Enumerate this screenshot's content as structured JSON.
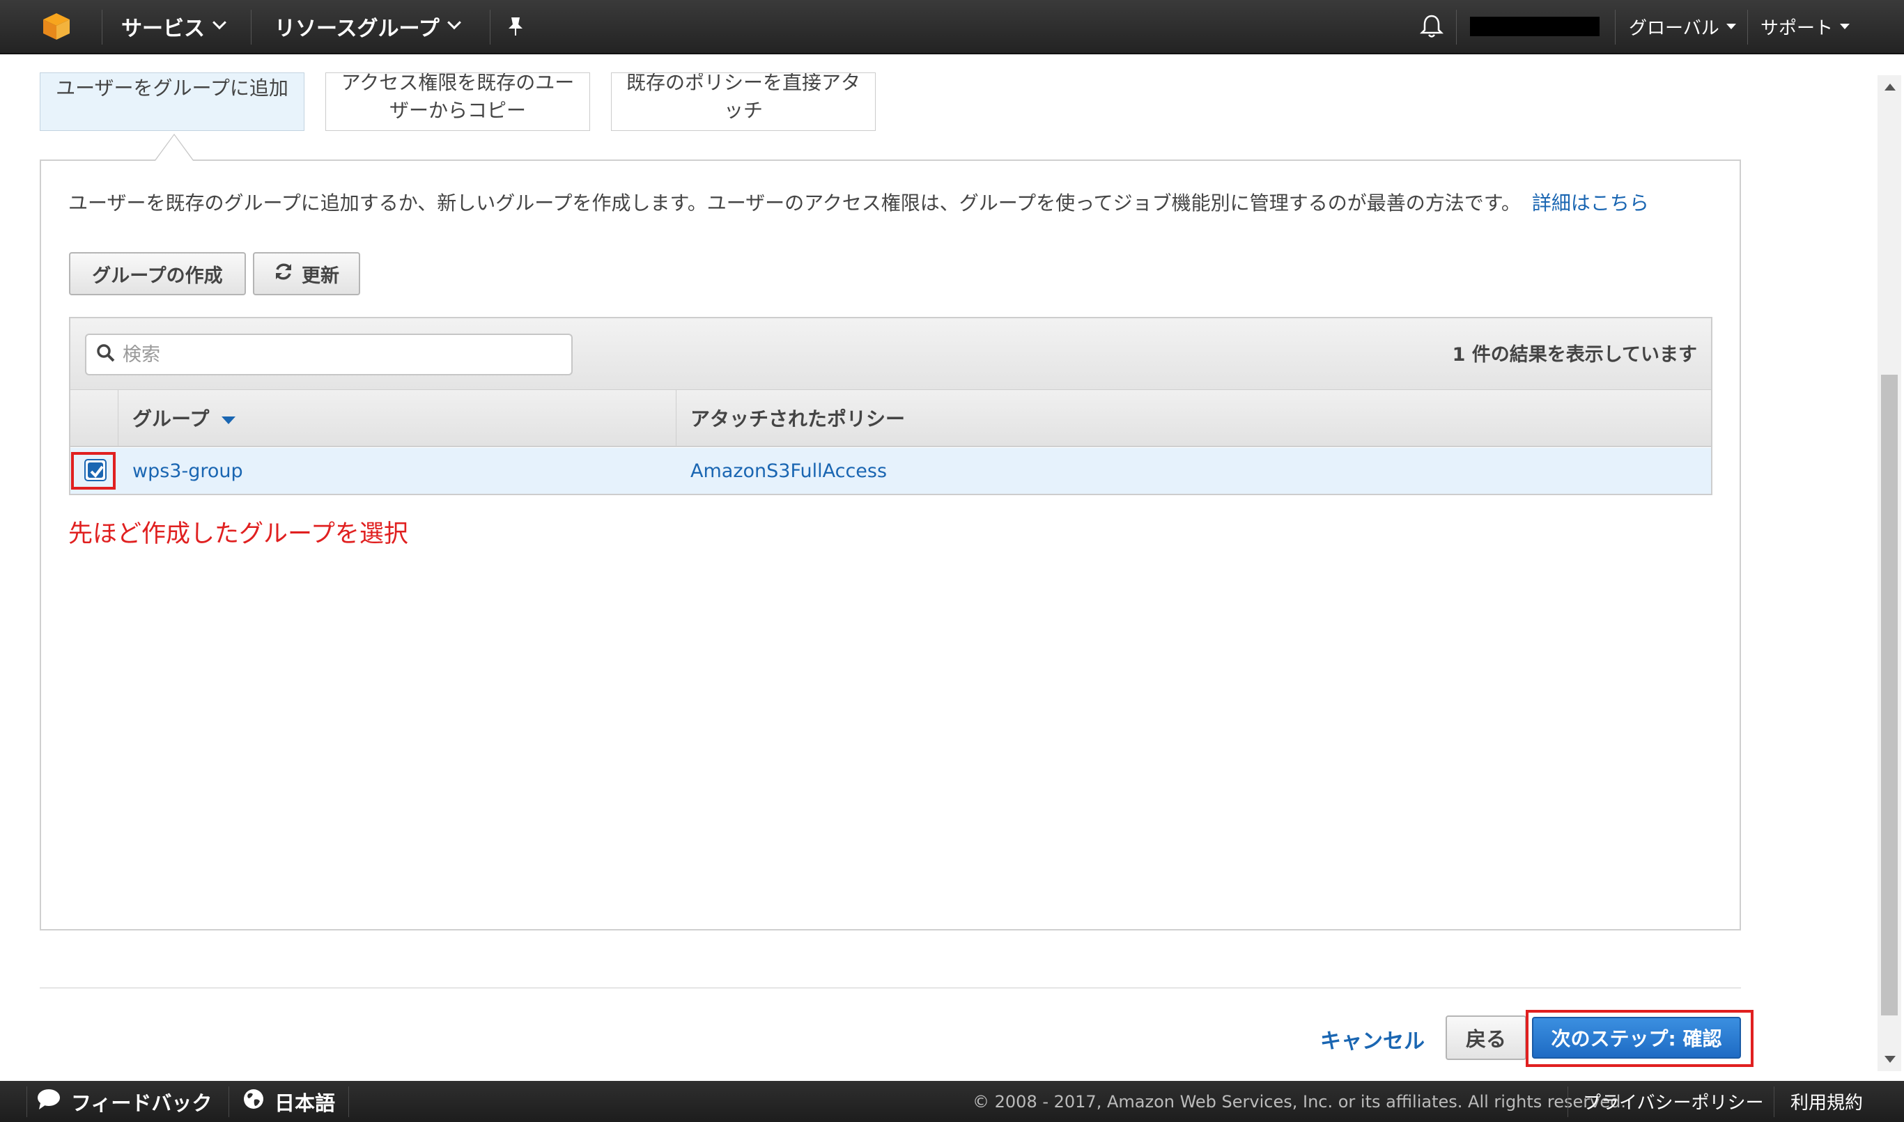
{
  "header": {
    "services_label": "サービス",
    "resource_groups_label": "リソースグループ",
    "region_label": "グローバル",
    "support_label": "サポート"
  },
  "tabs": [
    {
      "label_line1": "ユーザーをグループに追加",
      "label_line2": "",
      "active": true
    },
    {
      "label_line1": "アクセス権限を既存のユー",
      "label_line2": "ザーからコピー",
      "active": false
    },
    {
      "label_line1": "既存のポリシーを直接アタ",
      "label_line2": "ッチ",
      "active": false
    }
  ],
  "main": {
    "description": "ユーザーを既存のグループに追加するか、新しいグループを作成します。ユーザーのアクセス権限は、グループを使ってジョブ機能別に管理するのが最善の方法です。",
    "learn_more_label": "詳細はこちら",
    "create_group_label": "グループの作成",
    "refresh_label": "更新",
    "search_placeholder": "検索",
    "result_count": "1 件の結果を表示しています",
    "table": {
      "columns": [
        "グループ",
        "アタッチされたポリシー"
      ],
      "rows": [
        {
          "group": "wps3-group",
          "policy": "AmazonS3FullAccess",
          "checked": true
        }
      ]
    },
    "annotation": "先ほど作成したグループを選択"
  },
  "actions": {
    "cancel_label": "キャンセル",
    "back_label": "戻る",
    "next_label": "次のステップ: 確認"
  },
  "footer": {
    "feedback_label": "フィードバック",
    "language_label": "日本語",
    "copyright": "© 2008 - 2017, Amazon Web Services, Inc. or its affiliates. All rights reserved.",
    "privacy_label": "プライバシーポリシー",
    "terms_label": "利用規約"
  },
  "colors": {
    "accent": "#1a66b2",
    "primary_button": "#2b7bd1",
    "annotation_red": "#e02020",
    "header_bg": "#2b2b2b"
  },
  "icons": [
    "aws-cube-icon",
    "pin-icon",
    "bell-icon",
    "refresh-icon",
    "search-icon",
    "sort-down-icon",
    "checkbox-checked-icon",
    "chat-icon",
    "globe-icon"
  ]
}
